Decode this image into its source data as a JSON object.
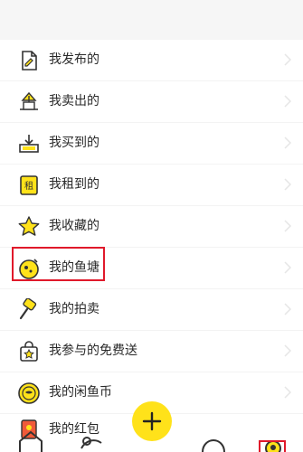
{
  "menu": {
    "items": [
      {
        "label": "我发布的",
        "icon": "document-icon"
      },
      {
        "label": "我卖出的",
        "icon": "sell-icon"
      },
      {
        "label": "我买到的",
        "icon": "bought-icon"
      },
      {
        "label": "我租到的",
        "icon": "rent-icon",
        "icon_text": "租"
      },
      {
        "label": "我收藏的",
        "icon": "star-icon"
      },
      {
        "label": "我的鱼塘",
        "icon": "fish-pond-icon"
      },
      {
        "label": "我的拍卖",
        "icon": "auction-hammer-icon"
      },
      {
        "label": "我参与的免费送",
        "icon": "gift-bag-icon"
      },
      {
        "label": "我的闲鱼币",
        "icon": "coin-icon"
      }
    ],
    "peek_item": {
      "label": "我的红包",
      "icon": "red-packet-icon"
    }
  },
  "colors": {
    "accent": "#ffe21a",
    "highlight_box": "#e0192b",
    "icon_stroke": "#333333"
  },
  "tabbar": {
    "icons": [
      "home-icon",
      "fish-icon",
      "publish-plus-icon",
      "message-icon",
      "profile-icon"
    ]
  }
}
